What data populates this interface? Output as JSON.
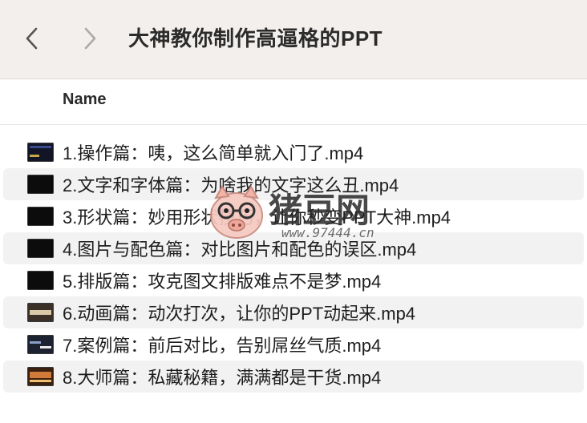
{
  "window": {
    "title": "大神教你制作高逼格的PPT"
  },
  "toolbar": {
    "back_icon": "chevron-left-icon",
    "forward_icon": "chevron-right-icon"
  },
  "header": {
    "name_col": "Name"
  },
  "files": [
    {
      "name": "1.操作篇：咦，这么简单就入门了.mp4",
      "thumb_color": "#1a2240"
    },
    {
      "name": "2.文字和字体篇：为啥我的文字这么丑.mp4",
      "thumb_color": "#0c0c10"
    },
    {
      "name": "3.形状篇：妙用形状技巧，让你秒变PPT大神.mp4",
      "thumb_color": "#0c0c10"
    },
    {
      "name": "4.图片与配色篇：对比图片和配色的误区.mp4",
      "thumb_color": "#0c0c10"
    },
    {
      "name": "5.排版篇：攻克图文排版难点不是梦.mp4",
      "thumb_color": "#0c0c10"
    },
    {
      "name": "6.动画篇：动次打次，让你的PPT动起来.mp4",
      "thumb_color": "#5a4a38"
    },
    {
      "name": "7.案例篇：前后对比，告别屌丝气质.mp4",
      "thumb_color": "#2a3040"
    },
    {
      "name": "8.大师篇：私藏秘籍，满满都是干货.mp4",
      "thumb_color": "#6a3a20"
    }
  ],
  "watermark": {
    "text": "猪豆网",
    "url": "www.97444.cn"
  }
}
